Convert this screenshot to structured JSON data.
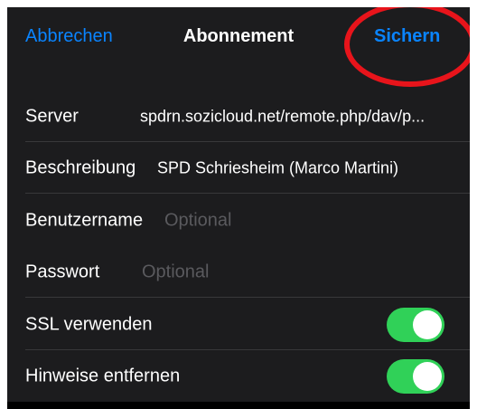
{
  "navbar": {
    "cancel_label": "Abbrechen",
    "title": "Abonnement",
    "save_label": "Sichern"
  },
  "form": {
    "server": {
      "label": "Server",
      "value": "spdrn.sozicloud.net/remote.php/dav/p..."
    },
    "description": {
      "label": "Beschreibung",
      "value": "SPD Schriesheim (Marco Martini)"
    },
    "username": {
      "label": "Benutzername",
      "placeholder": "Optional"
    },
    "password": {
      "label": "Passwort",
      "placeholder": "Optional"
    },
    "use_ssl": {
      "label": "SSL verwenden",
      "enabled": true
    },
    "remove_alerts": {
      "label": "Hinweise entfernen",
      "enabled": true
    }
  },
  "colors": {
    "accent": "#0a84ff",
    "toggle_on": "#30d158",
    "highlight": "#e8141b"
  }
}
